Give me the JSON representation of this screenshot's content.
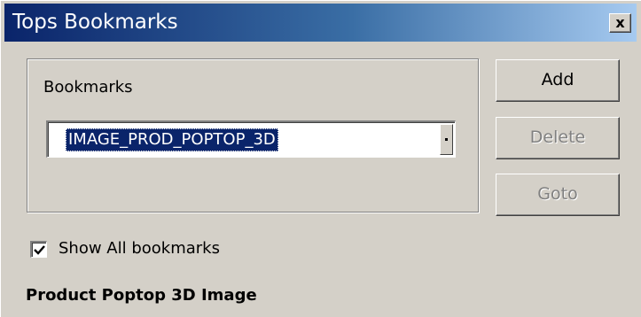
{
  "window": {
    "title": "Tops Bookmarks",
    "close_label": "x"
  },
  "bookmarks_group": {
    "label": "Bookmarks",
    "selected_value": "IMAGE_PROD_POPTOP_3D"
  },
  "buttons": {
    "add": "Add",
    "delete": "Delete",
    "goto": "Goto"
  },
  "show_all": {
    "label": "Show All bookmarks",
    "checked": true
  },
  "description": "Product Poptop 3D Image",
  "colors": {
    "title_start": "#0a246a",
    "title_end": "#a6caf0",
    "face": "#d4d0c8",
    "selection": "#0a246a"
  }
}
